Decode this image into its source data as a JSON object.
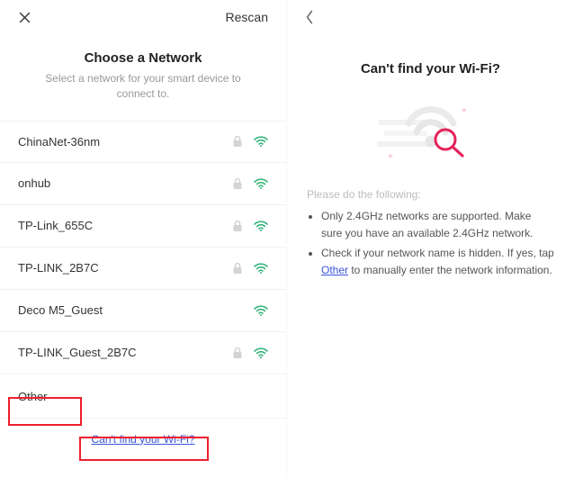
{
  "left": {
    "rescan_label": "Rescan",
    "title": "Choose a Network",
    "subtitle": "Select a network for your smart device to connect to.",
    "networks": [
      {
        "ssid": "ChinaNet-36nm",
        "locked": true
      },
      {
        "ssid": "onhub",
        "locked": true
      },
      {
        "ssid": "TP-Link_655C",
        "locked": true
      },
      {
        "ssid": "TP-LINK_2B7C",
        "locked": true
      },
      {
        "ssid": "Deco M5_Guest",
        "locked": false
      },
      {
        "ssid": "TP-LINK_Guest_2B7C",
        "locked": true
      }
    ],
    "other_label": "Other",
    "cant_find_label": "Can't find your Wi-Fi?"
  },
  "right": {
    "title": "Can't find your Wi-Fi?",
    "please_label": "Please do the following:",
    "bullet1": "Only 2.4GHz networks are supported. Make sure you have an available 2.4GHz network.",
    "bullet2_pre": "Check if your network name is hidden. If yes, tap ",
    "bullet2_link": "Other",
    "bullet2_post": " to manually enter the network information."
  }
}
